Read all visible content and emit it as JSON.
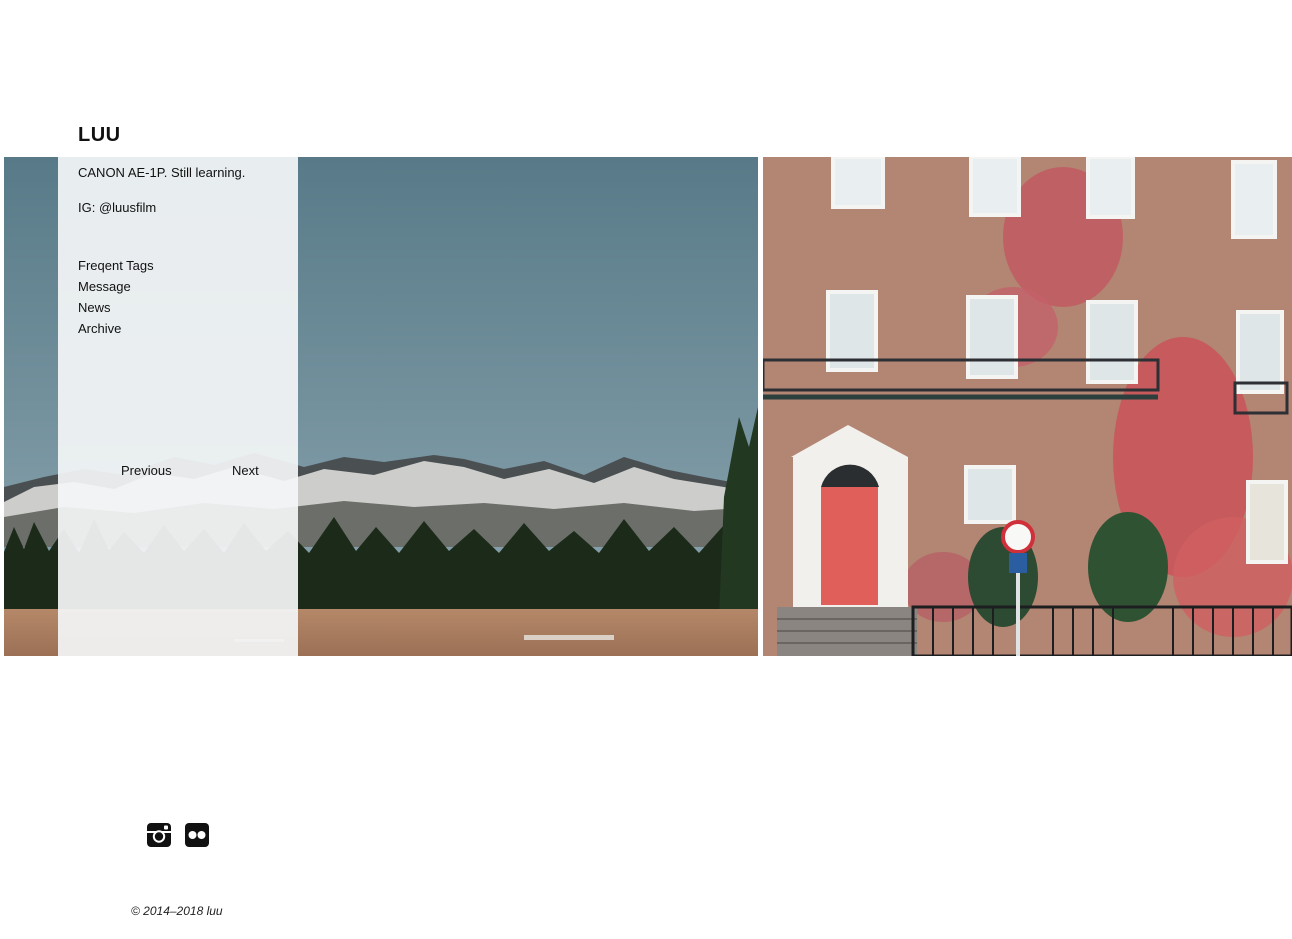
{
  "site": {
    "title": "LUU"
  },
  "sidebar": {
    "description": "CANON AE-1P. Still learning.",
    "instagram": "IG: @luusfilm",
    "nav": [
      {
        "label": "Freqent Tags"
      },
      {
        "label": "Message"
      },
      {
        "label": "News"
      },
      {
        "label": "Archive"
      }
    ],
    "pager": {
      "previous": "Previous",
      "next": "Next"
    }
  },
  "photos": [
    {
      "subject": "snowy mountains with pine forest and dry meadow"
    },
    {
      "subject": "ivy-covered brick townhouse with red door and taxi sign"
    }
  ],
  "social": {
    "icons": [
      "instagram-icon",
      "flickr-icon"
    ]
  },
  "footer": {
    "copyright": "© 2014–2018 luu"
  },
  "colors": {
    "sky": "#5b7d8c",
    "forest": "#1f2e1c",
    "meadow": "#a97a5a",
    "brick": "#b98a76",
    "ivy": "#c9545b",
    "door": "#e2605e",
    "sidebar_bg": "#f3f5f6"
  }
}
